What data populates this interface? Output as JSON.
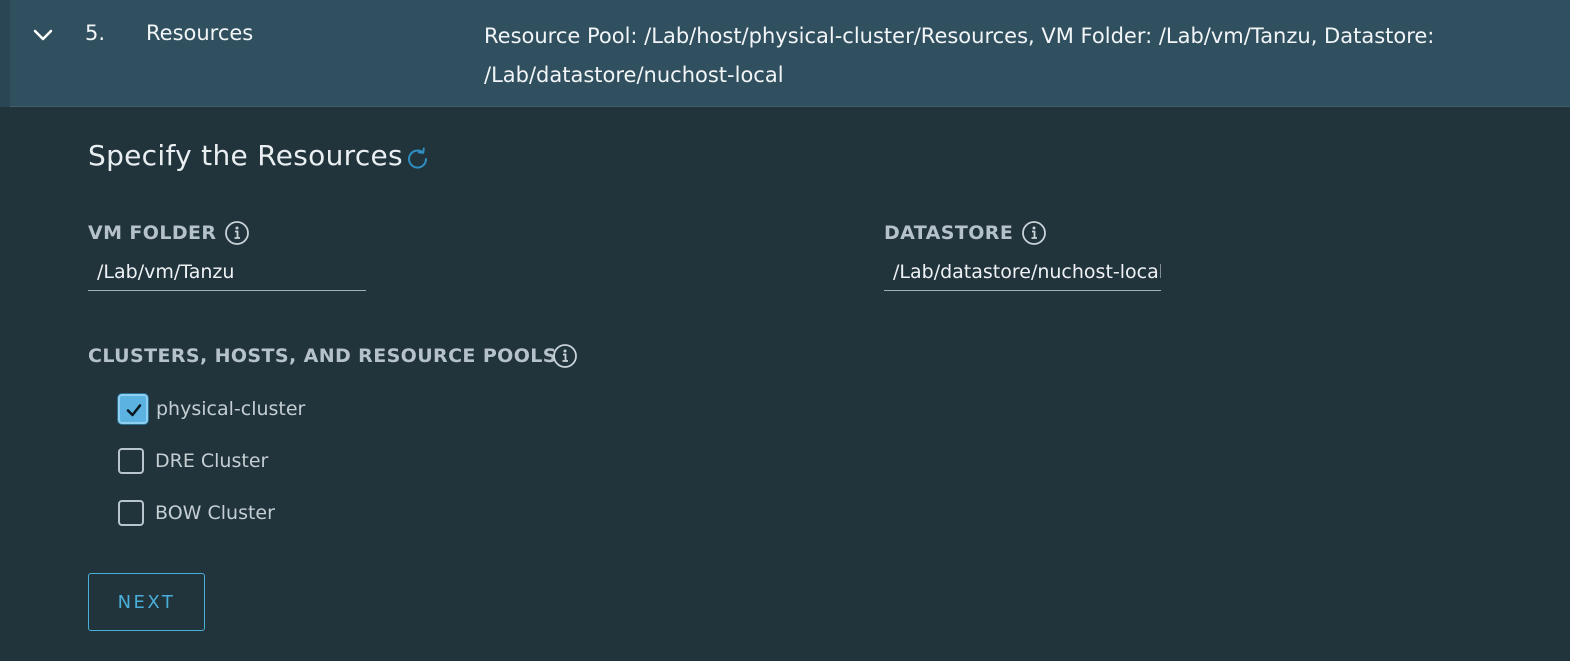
{
  "step": {
    "number": "5.",
    "title": "Resources",
    "summary": "Resource Pool: /Lab/host/physical-cluster/Resources, VM Folder: /Lab/vm/Tanzu, Datastore: /Lab/datastore/nuchost-local"
  },
  "section": {
    "title": "Specify the Resources",
    "refresh_icon": "refresh-icon"
  },
  "vm_folder": {
    "label": "VM FOLDER",
    "value": "/Lab/vm/Tanzu",
    "info_icon": "info-icon"
  },
  "datastore": {
    "label": "DATASTORE",
    "value": "/Lab/datastore/nuchost-local",
    "info_icon": "info-icon"
  },
  "clusters": {
    "label": "CLUSTERS, HOSTS, AND RESOURCE POOLS",
    "info_icon": "info-icon",
    "items": [
      {
        "label": "physical-cluster",
        "checked": true
      },
      {
        "label": "DRE Cluster",
        "checked": false
      },
      {
        "label": "BOW Cluster",
        "checked": false
      }
    ]
  },
  "actions": {
    "next_label": "NEXT"
  },
  "colors": {
    "background": "#21333b",
    "header": "#31505f",
    "accent": "#49afd9",
    "checkbox_checked": "#5cb2e0"
  }
}
